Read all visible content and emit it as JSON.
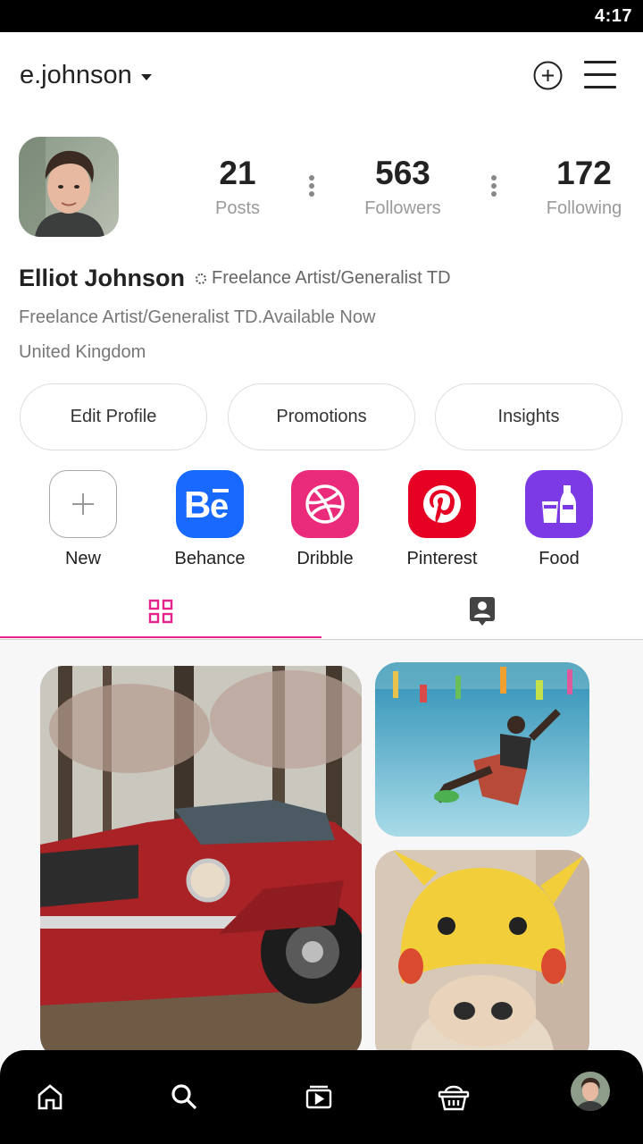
{
  "status_bar": {
    "time": "4:17"
  },
  "header": {
    "username": "e.johnson"
  },
  "profile": {
    "stats": [
      {
        "value": "21",
        "label": "Posts"
      },
      {
        "value": "563",
        "label": "Followers"
      },
      {
        "value": "172",
        "label": "Following"
      }
    ],
    "name": "Elliot Johnson",
    "category": "Freelance Artist/Generalist TD",
    "bio": "Freelance Artist/Generalist TD.Available Now",
    "location": "United Kingdom"
  },
  "actions": {
    "edit": "Edit Profile",
    "promotions": "Promotions",
    "insights": "Insights"
  },
  "highlights": [
    {
      "label": "New",
      "icon": "plus-icon",
      "color": "#ffffff"
    },
    {
      "label": "Behance",
      "icon": "behance-icon",
      "color": "#1769ff"
    },
    {
      "label": "Dribble",
      "icon": "dribbble-icon",
      "color": "#ea2a7a"
    },
    {
      "label": "Pinterest",
      "icon": "pinterest-icon",
      "color": "#e60023"
    },
    {
      "label": "Food",
      "icon": "food-drink-icon",
      "color": "#7c3ae6"
    }
  ],
  "tabs": [
    {
      "icon": "grid-icon",
      "active": true
    },
    {
      "icon": "tagged-person-icon",
      "active": false
    }
  ],
  "posts": [
    {
      "subject": "red-classic-car-photo"
    },
    {
      "subject": "underwater-pool-photo"
    },
    {
      "subject": "cat-in-pikachu-hat-photo"
    }
  ],
  "bottom_nav": [
    "home-icon",
    "search-icon",
    "reels-icon",
    "shop-basket-icon",
    "profile-avatar"
  ],
  "colors": {
    "accent": "#e5238b",
    "nav_bg": "#000000"
  }
}
